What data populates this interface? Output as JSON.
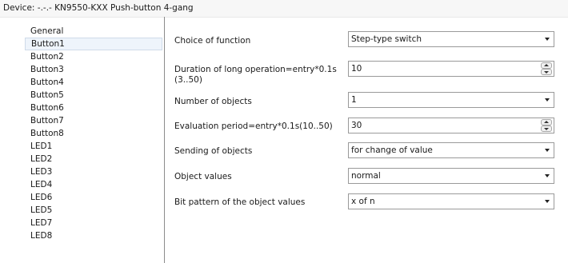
{
  "title": "Device: -.-.- KN9550-KXX Push-button 4-gang",
  "sidebar": {
    "items": [
      {
        "label": "General"
      },
      {
        "label": "Button1"
      },
      {
        "label": "Button2"
      },
      {
        "label": "Button3"
      },
      {
        "label": "Button4"
      },
      {
        "label": "Button5"
      },
      {
        "label": "Button6"
      },
      {
        "label": "Button7"
      },
      {
        "label": "Button8"
      },
      {
        "label": "LED1"
      },
      {
        "label": "LED2"
      },
      {
        "label": "LED3"
      },
      {
        "label": "LED4"
      },
      {
        "label": "LED6"
      },
      {
        "label": "LED5"
      },
      {
        "label": "LED7"
      },
      {
        "label": "LED8"
      }
    ],
    "selected": "Button1"
  },
  "params": [
    {
      "label": "Choice of function",
      "value": "Step-type switch",
      "control": "dropdown"
    },
    {
      "label": "Duration of long operation=entry*0.1s (3..50)",
      "value": "10",
      "control": "spin"
    },
    {
      "label": "Number of objects",
      "value": "1",
      "control": "dropdown"
    },
    {
      "label": "Evaluation period=entry*0.1s(10..50)",
      "value": "30",
      "control": "spin"
    },
    {
      "label": "Sending of objects",
      "value": "for change of value",
      "control": "dropdown"
    },
    {
      "label": "Object values",
      "value": "normal",
      "control": "dropdown"
    },
    {
      "label": "Bit pattern of the object values",
      "value": "x of n",
      "control": "dropdown"
    }
  ],
  "icons": {
    "dropdown": "chevron-down-icon",
    "spin_up": "spin-up-icon",
    "spin_down": "spin-down-icon"
  }
}
